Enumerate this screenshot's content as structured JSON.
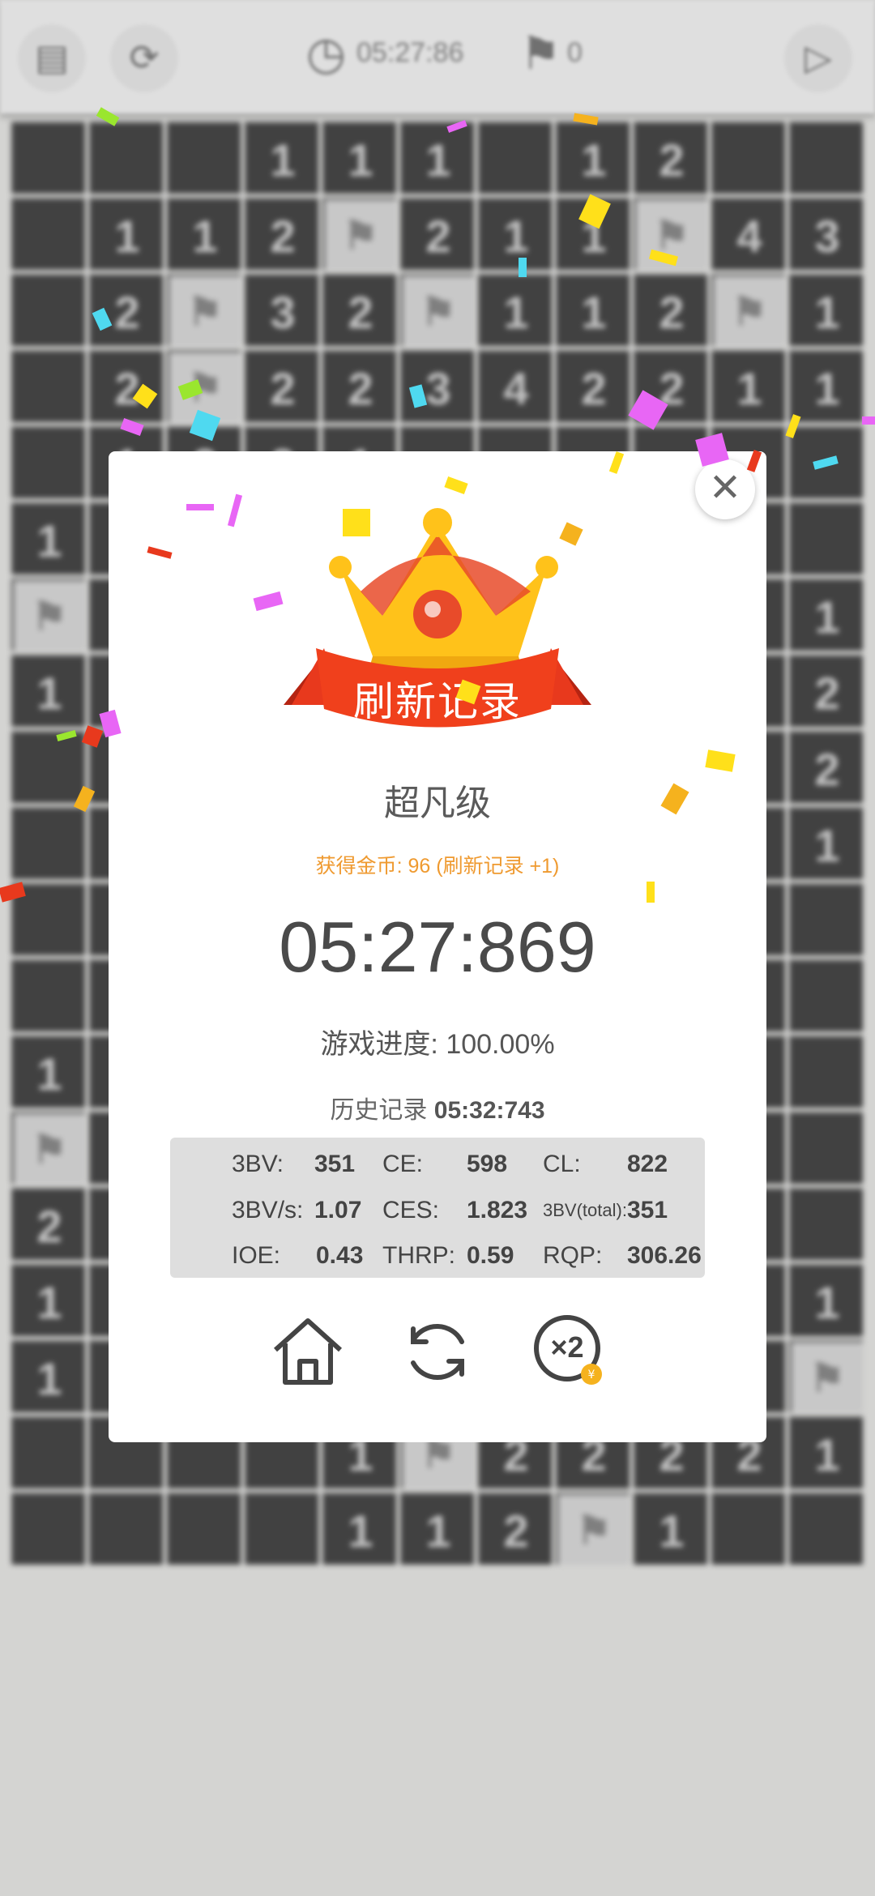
{
  "toolbar": {
    "timer": "05:27:86",
    "flags": "0"
  },
  "board": {
    "rows": [
      [
        "",
        "",
        "",
        "1",
        "1",
        "1",
        "",
        "1",
        "2",
        "",
        ""
      ],
      [
        "",
        "1",
        "1",
        "2",
        "F",
        "2",
        "1",
        "1",
        "F",
        "4",
        "3"
      ],
      [
        "",
        "2",
        "F",
        "3",
        "2",
        "F",
        "1",
        "1",
        "2",
        "F",
        "1"
      ],
      [
        "",
        "2",
        "F",
        "2",
        "2",
        "3",
        "4",
        "2",
        "2",
        "1",
        "1"
      ],
      [
        "",
        "1",
        "2",
        "2",
        "1",
        "",
        "",
        "",
        "",
        "",
        ""
      ],
      [
        "1",
        "",
        "",
        "",
        "",
        "",
        "",
        "",
        "",
        "",
        ""
      ],
      [
        "F",
        "",
        "",
        "",
        "",
        "",
        "",
        "",
        "",
        "",
        "1"
      ],
      [
        "1",
        "",
        "",
        "",
        "",
        "",
        "",
        "",
        "",
        "",
        "2"
      ],
      [
        "",
        "",
        "",
        "",
        "",
        "",
        "",
        "",
        "",
        "",
        "2"
      ],
      [
        "",
        "",
        "",
        "",
        "",
        "",
        "",
        "",
        "",
        "",
        "1"
      ],
      [
        "",
        "",
        "",
        "",
        "",
        "",
        "",
        "",
        "",
        "",
        ""
      ],
      [
        "",
        "",
        "",
        "",
        "",
        "",
        "",
        "",
        "",
        "",
        ""
      ],
      [
        "1",
        "",
        "",
        "",
        "",
        "",
        "",
        "",
        "",
        "",
        ""
      ],
      [
        "F",
        "",
        "",
        "",
        "",
        "",
        "",
        "",
        "",
        "",
        ""
      ],
      [
        "2",
        "",
        "",
        "",
        "",
        "",
        "",
        "",
        "",
        "",
        ""
      ],
      [
        "1",
        "",
        "",
        "",
        "",
        "",
        "",
        "",
        "",
        "",
        "1"
      ],
      [
        "1",
        "",
        "",
        "",
        "",
        "",
        "",
        "",
        "",
        "",
        "F"
      ],
      [
        "",
        "",
        "",
        "",
        "1",
        "F",
        "2",
        "2",
        "2",
        "2",
        "1"
      ],
      [
        "",
        "",
        "",
        "",
        "1",
        "1",
        "2",
        "F",
        "1",
        "",
        ""
      ]
    ]
  },
  "dialog": {
    "ribbon": "刷新记录",
    "level": "超凡级",
    "coins": "获得金币: 96 (刷新记录 +1)",
    "time": "05:27:869",
    "progress": "游戏进度: 100.00%",
    "history_label": "历史记录",
    "history_value": "05:32:743",
    "stats": {
      "bv_label": "3BV:",
      "bv": "351",
      "ce_label": "CE:",
      "ce": "598",
      "cl_label": "CL:",
      "cl": "822",
      "bvs_label": "3BV/s:",
      "bvs": "1.07",
      "ces_label": "CES:",
      "ces": "1.823",
      "bvtotal_label": "3BV(total):",
      "bvtotal": "351",
      "ioe_label": "IOE:",
      "ioe": "0.43",
      "thrp_label": "THRP:",
      "thrp": "0.59",
      "rqp_label": "RQP:",
      "rqp": "306.26"
    },
    "double_badge": "×2"
  },
  "colors": {
    "accent_orange": "#ef9a30",
    "ribbon_red": "#e8391d",
    "crown_gold": "#ffc21a"
  }
}
